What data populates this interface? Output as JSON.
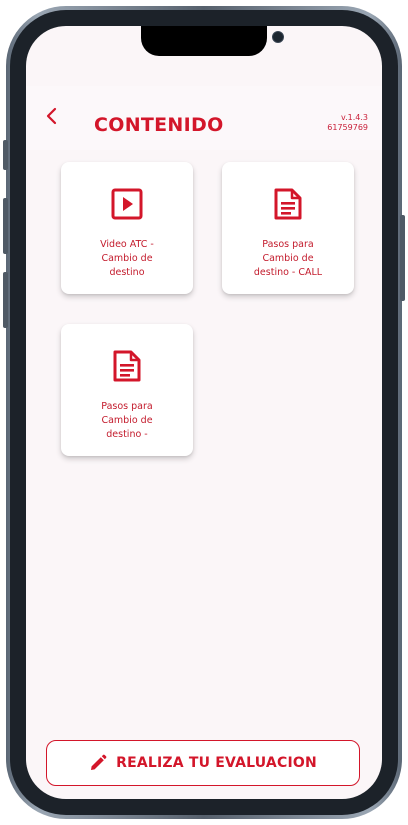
{
  "header": {
    "title": "CONTENIDO",
    "version_line1": "v.1.4.3",
    "version_line2": "61759769"
  },
  "cards": [
    {
      "label": "Video ATC -\nCambio de\ndestino",
      "icon": "play-video-icon"
    },
    {
      "label": "Pasos para\nCambio de\ndestino - CALL",
      "icon": "document-icon"
    },
    {
      "label": "Pasos para\nCambio de\ndestino -",
      "icon": "document-icon"
    }
  ],
  "evaluation_button": {
    "label": "REALIZA TU EVALUACION",
    "icon": "pencil-icon"
  },
  "colors": {
    "accent": "#d3162a",
    "screen_background": "#fbf6f8",
    "card_background": "#ffffff"
  }
}
